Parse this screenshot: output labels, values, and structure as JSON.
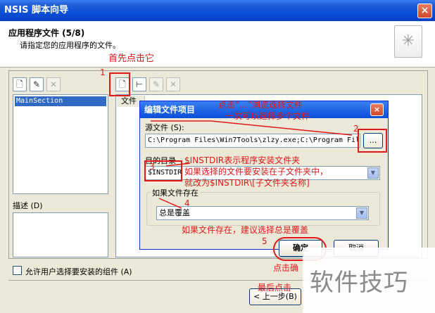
{
  "window": {
    "title": "NSIS 脚本向导",
    "close_label": "×"
  },
  "header": {
    "title": "应用程序文件 (5/8)",
    "subtitle": "请指定您的应用程序的文件。"
  },
  "sections": {
    "items": [
      "MainSection"
    ],
    "desc_label": "描述 (D)"
  },
  "files": {
    "column": "文件"
  },
  "checkbox": {
    "label": "允许用户选择要安装的组件 (A)"
  },
  "footer": {
    "back_label": "< 上一步(B)"
  },
  "dialog": {
    "title": "编辑文件项目",
    "close_label": "×",
    "source_label": "源文件 (S):",
    "source_value": "C:\\Program Files\\Win7Tools\\zlzy.exe;C:\\Program Fil",
    "browse_label": "...",
    "dest_label": "目的目录",
    "dest_value": "$INSTDIR",
    "exists_group": "如果文件存在",
    "exists_value": "总是覆盖",
    "ok_label": "确定",
    "cancel_label": "取消"
  },
  "annotations": {
    "n1": "1",
    "n2": "2",
    "n3": "3",
    "n4": "4",
    "n5": "5",
    "a1": "首先点击它",
    "a2a": "点击“...”浏览选择文件",
    "a2b": "一次可以选择多个文件",
    "a3a": "$INSTDIR表示程序安装文件夹",
    "a3b": "如果选择的文件要安装在子文件夹中，",
    "a3c": "就改为$INSTDIR\\[子文件夹名称]",
    "a4": "如果文件存在，建议选择总是覆盖",
    "a5": "点击确",
    "a6": "最后点击"
  },
  "watermark": "软件技巧",
  "colors": {
    "annotation": "#e01818",
    "titlebar": "#0a4fd8"
  }
}
